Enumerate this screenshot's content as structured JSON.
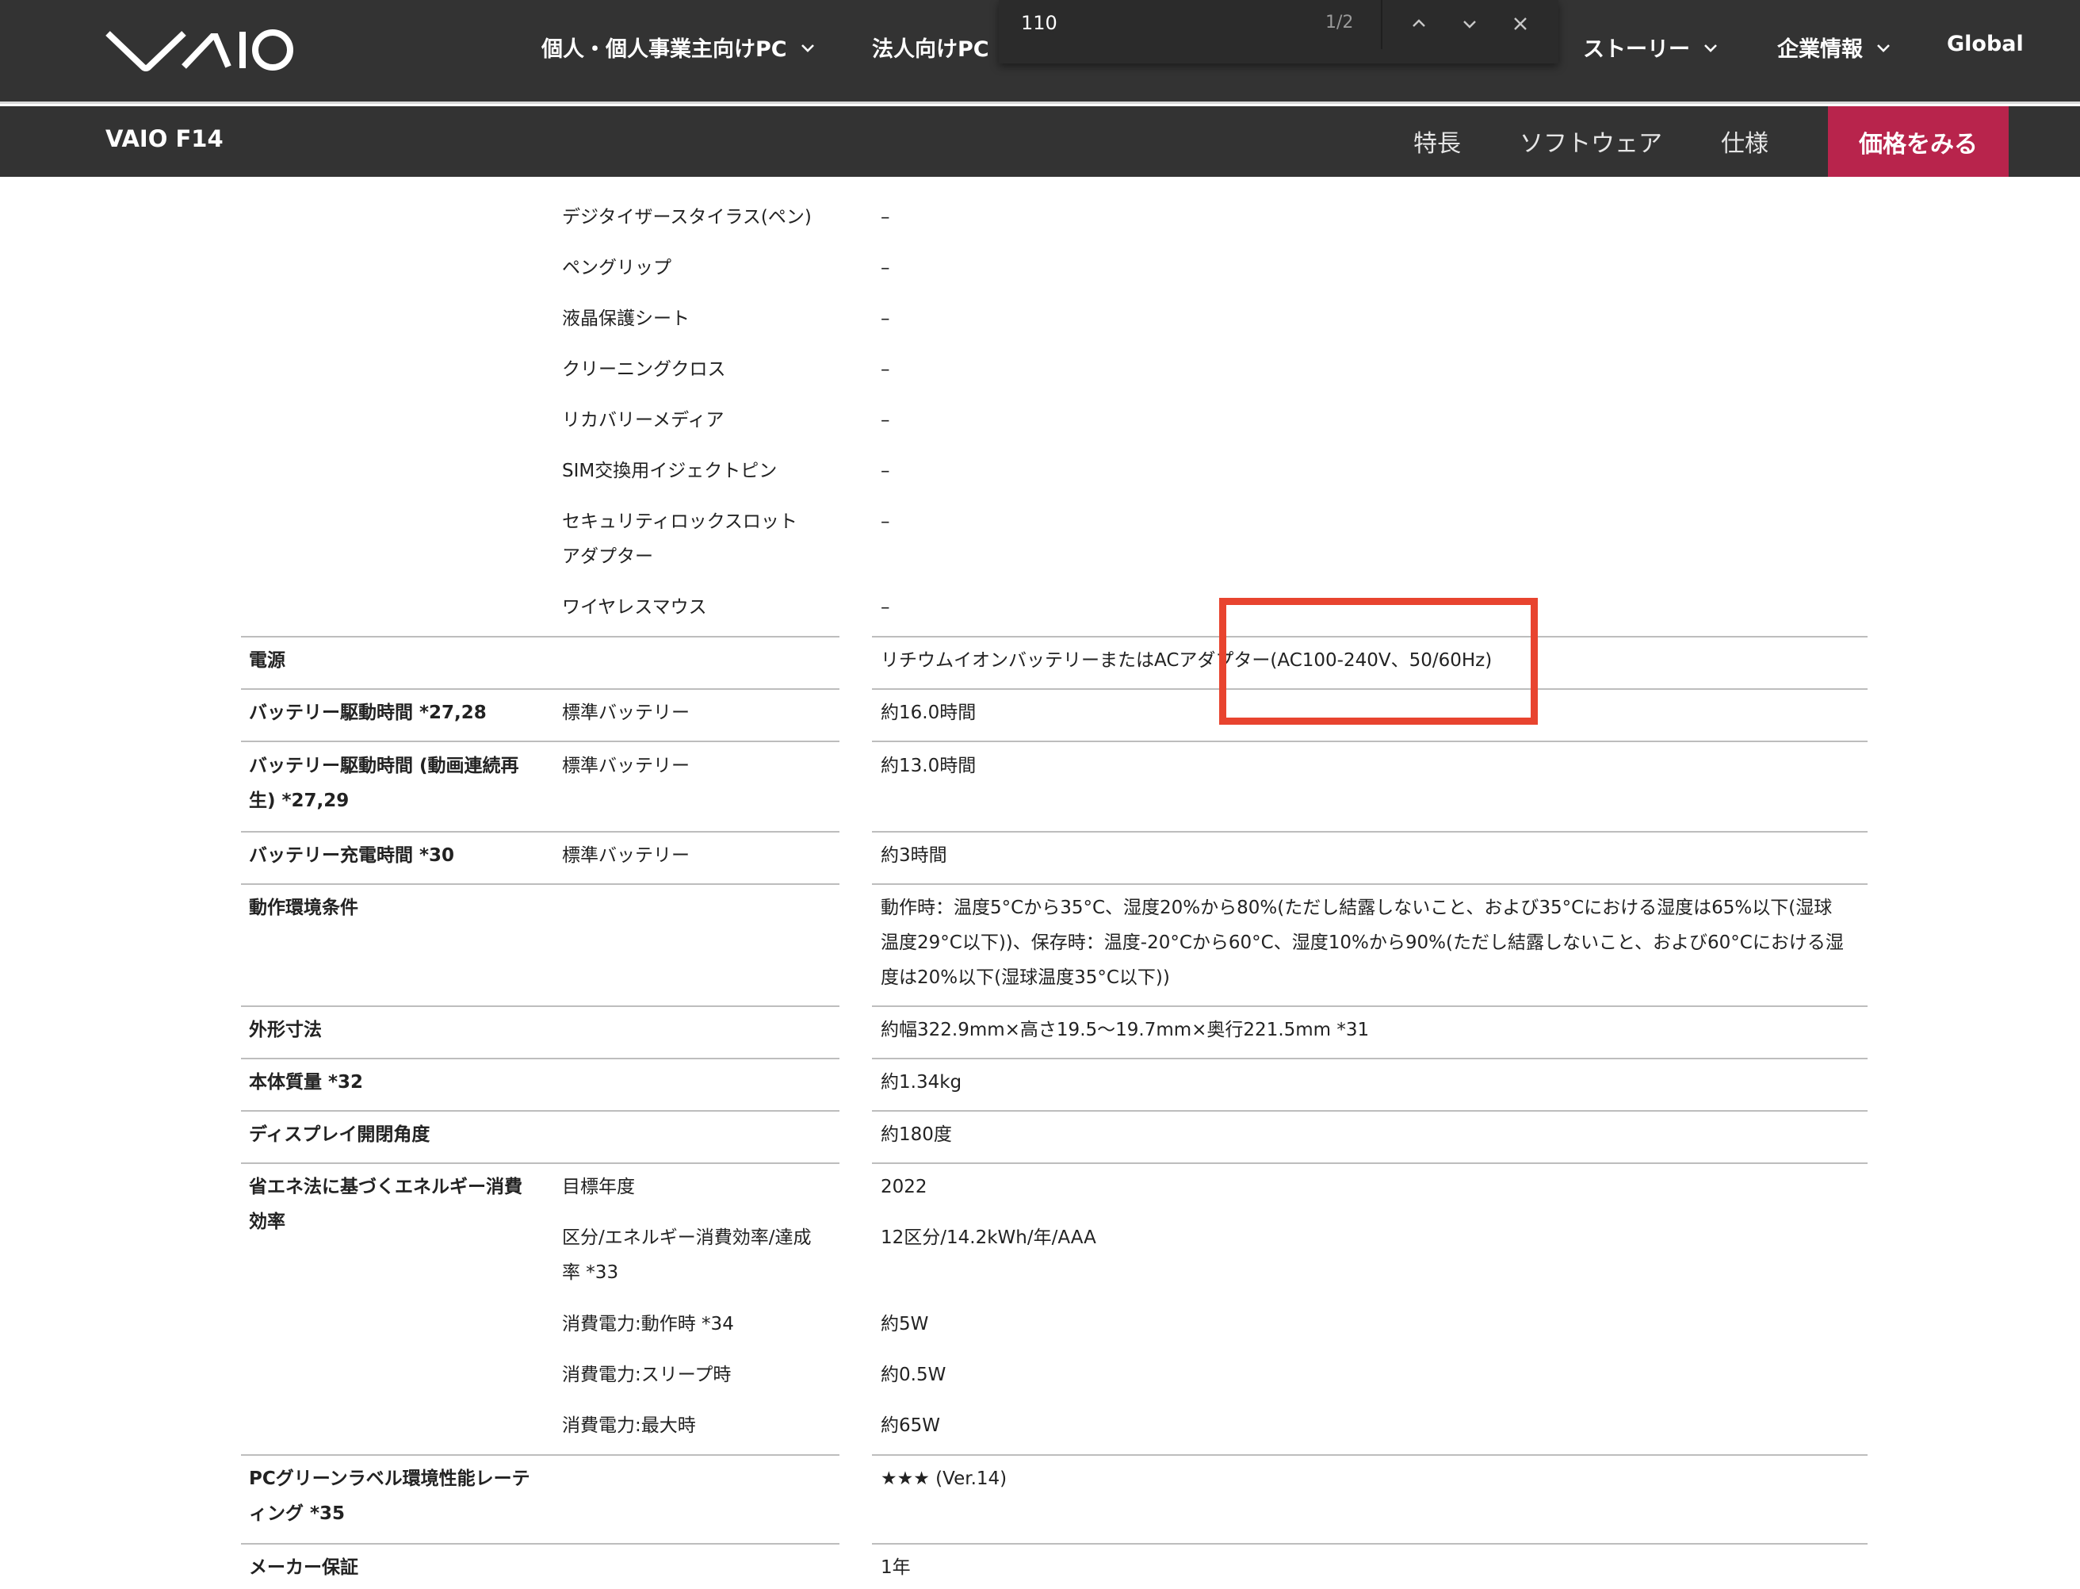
{
  "topnav": {
    "logo": "VAIO",
    "menu": [
      {
        "label": "個人・個人事業主向けPC",
        "dropdown": true
      },
      {
        "label": "法人向けPC",
        "dropdown": false
      },
      {
        "label": "ストーリー",
        "dropdown": true
      },
      {
        "label": "企業情報",
        "dropdown": true
      },
      {
        "label": "Global",
        "dropdown": false
      }
    ]
  },
  "findbar": {
    "query": "110",
    "count": "1/2",
    "icons": [
      "chevron-up-icon",
      "chevron-down-icon",
      "close-icon"
    ]
  },
  "subnav": {
    "title": "VAIO F14",
    "links": [
      "特長",
      "ソフトウェア",
      "仕様"
    ],
    "price_button": "価格をみる"
  },
  "specs": {
    "accessories": [
      {
        "item": "デジタイザースタイラス(ペン)",
        "value": "–"
      },
      {
        "item": "ペングリップ",
        "value": "–"
      },
      {
        "item": "液晶保護シート",
        "value": "–"
      },
      {
        "item": "クリーニングクロス",
        "value": "–"
      },
      {
        "item": "リカバリーメディア",
        "value": "–"
      },
      {
        "item": "SIM交換用イジェクトピン",
        "value": "–"
      },
      {
        "item": "セキュリティロックスロット",
        "item_line2": "アダプター",
        "value": "–"
      },
      {
        "item": "ワイヤレスマウス",
        "value": "–"
      }
    ],
    "power": {
      "label": "電源",
      "value": "リチウムイオンバッテリーまたはACアダプター(AC100-240V、50/60Hz)"
    },
    "battery_life": {
      "label": "バッテリー駆動時間 *27,28",
      "sub": "標準バッテリー",
      "value": "約16.0時間"
    },
    "battery_video": {
      "label": "バッテリー駆動時間 (動画連続再",
      "label_line2": "生) *27,29",
      "sub": "標準バッテリー",
      "value": "約13.0時間"
    },
    "battery_charge": {
      "label": "バッテリー充電時間 *30",
      "sub": "標準バッテリー",
      "value": "約3時間"
    },
    "environment": {
      "label": "動作環境条件",
      "value_lines": [
        "動作時：温度5°Cから35°C、湿度20%から80%(ただし結露しないこと、および35°Cにおける湿度は65%以下(湿球",
        "温度29°C以下))、保存時：温度-20°Cから60°C、湿度10%から90%(ただし結露しないこと、および60°Cにおける湿",
        "度は20%以下(湿球温度35°C以下))"
      ]
    },
    "dimensions": {
      "label": "外形寸法",
      "value": "約幅322.9mm×高さ19.5〜19.7mm×奥行221.5mm *31"
    },
    "weight": {
      "label": "本体質量 *32",
      "value": "約1.34kg"
    },
    "hinge": {
      "label": "ディスプレイ開閉角度",
      "value": "約180度"
    },
    "energy": {
      "label": "省エネ法に基づくエネルギー消費",
      "label_line2": "効率",
      "rows": [
        {
          "sub": "目標年度",
          "value": "2022"
        },
        {
          "sub": "区分/エネルギー消費効率/達成",
          "sub_line2": "率 *33",
          "value": "12区分/14.2kWh/年/AAA"
        },
        {
          "sub": "消費電力:動作時 *34",
          "value": "約5W"
        },
        {
          "sub": "消費電力:スリープ時",
          "value": "約0.5W"
        },
        {
          "sub": "消費電力:最大時",
          "value": "約65W"
        }
      ]
    },
    "green": {
      "label": "PCグリーンラベル環境性能レーテ",
      "label_line2": "ィング *35",
      "value": "★★★ (Ver.14)"
    },
    "warranty": {
      "label": "メーカー保証",
      "value": "1年"
    }
  },
  "colors": {
    "nav_bg": "#333333",
    "price_button": "#b8244c",
    "highlight": "#e8442f"
  }
}
